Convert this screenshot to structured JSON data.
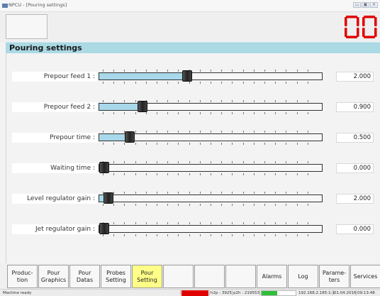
{
  "window": {
    "title": "NPCU - [Pouring settings]",
    "controls": [
      "minimize-icon",
      "maximize-icon",
      "close-icon"
    ]
  },
  "header": {
    "counter_value": "00",
    "counter_color": "#e00000"
  },
  "section": {
    "title": "Pouring settings",
    "color": "#abd9e4"
  },
  "settings": [
    {
      "label": "Prepour feed 1 :",
      "value": "2.000",
      "level": 0.39
    },
    {
      "label": "Prepour feed 2 :",
      "value": "0.900",
      "level": 0.18
    },
    {
      "label": "Prepour time :",
      "value": "0.500",
      "level": 0.12
    },
    {
      "label": "Waiting time :",
      "value": "0.000",
      "level": 0.0
    },
    {
      "label": "Level regulator gain :",
      "value": "2.000",
      "level": 0.02
    },
    {
      "label": "Jet regulator gain :",
      "value": "0.000",
      "level": 0.0
    }
  ],
  "toolbar": {
    "buttons": [
      {
        "name": "production",
        "line1": "Produc-",
        "line2": "tion",
        "active": false
      },
      {
        "name": "pour-graphics",
        "line1": "Pour",
        "line2": "Graphics",
        "active": false
      },
      {
        "name": "pour-datas",
        "line1": "Pour",
        "line2": "Datas",
        "active": false
      },
      {
        "name": "probes-setting",
        "line1": "Probes",
        "line2": "Setting",
        "active": false
      },
      {
        "name": "pour-setting",
        "line1": "Pour",
        "line2": "Setting",
        "active": true
      },
      {
        "name": "empty-1",
        "line1": "",
        "line2": "",
        "active": false
      },
      {
        "name": "empty-2",
        "line1": "",
        "line2": "",
        "active": false
      },
      {
        "name": "empty-3",
        "line1": "",
        "line2": "",
        "active": false
      },
      {
        "name": "alarms",
        "line1": "Alarms",
        "line2": "",
        "active": false
      },
      {
        "name": "log",
        "line1": "Log",
        "line2": "",
        "active": false
      },
      {
        "name": "parameters",
        "line1": "Parame-",
        "line2": "ters",
        "active": false
      },
      {
        "name": "services",
        "line1": "Services",
        "line2": "",
        "active": false
      }
    ],
    "active_color": "#ffff88"
  },
  "status": {
    "message": "Machine ready",
    "h2p": "h2p : 3925",
    "p2h": "p2h : 219553",
    "ip": "192.168.2.185:1:1",
    "date": "01.04.2016",
    "time": "09:13:48",
    "alarm_color": "#e00000",
    "progress_color": "#2fbf3a",
    "progress_level": 0.45
  }
}
